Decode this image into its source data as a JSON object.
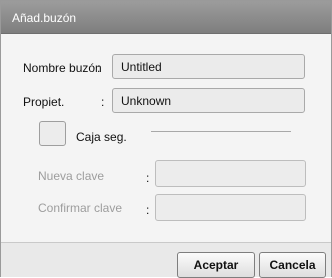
{
  "window": {
    "title": "Añad.buzón"
  },
  "form": {
    "name": {
      "label": "Nombre buzón",
      "colon": ":",
      "value": "Untitled"
    },
    "owner": {
      "label": "Propiet.",
      "colon": ":",
      "value": "Unknown"
    },
    "safe_box": {
      "label": "Caja seg.",
      "checked": false
    },
    "new_password": {
      "label": "Nueva clave",
      "colon": ":",
      "value": ""
    },
    "confirm_password": {
      "label": "Confirmar clave",
      "colon": ":",
      "value": ""
    }
  },
  "buttons": {
    "accept": "Aceptar",
    "cancel": "Cancela"
  }
}
